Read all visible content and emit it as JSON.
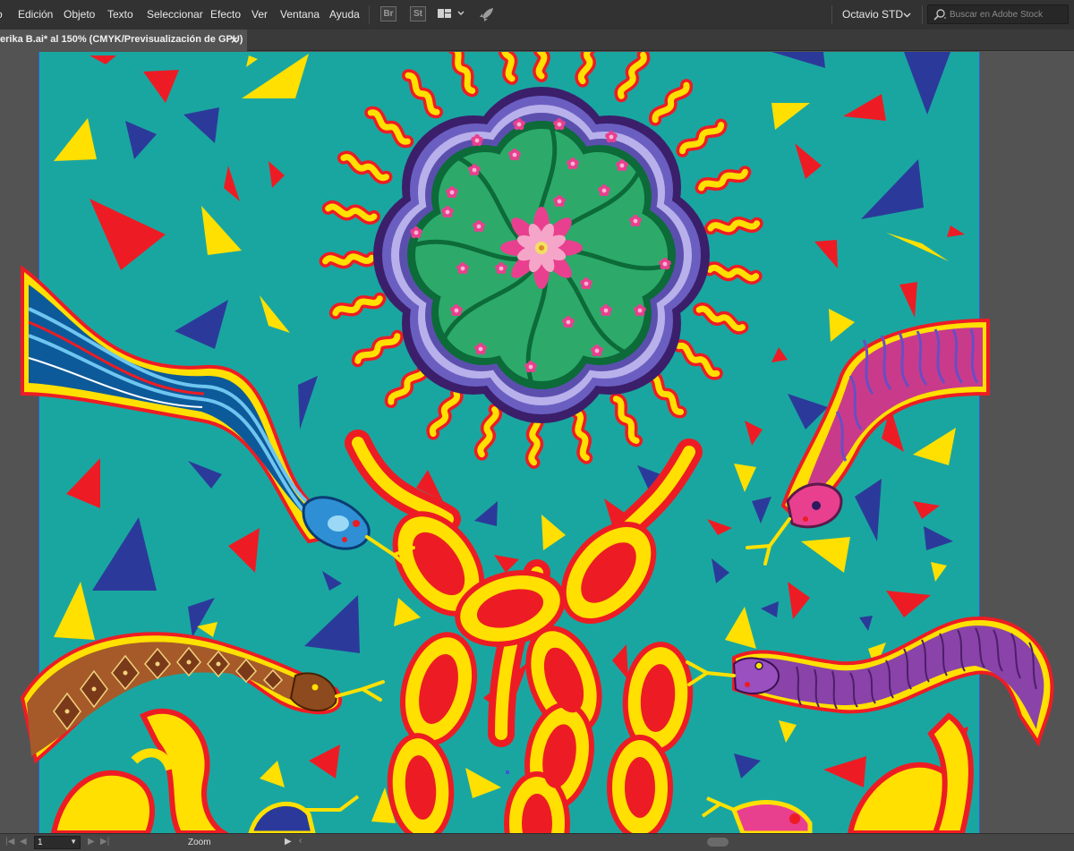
{
  "menubar": {
    "items": [
      "o",
      "Edición",
      "Objeto",
      "Texto",
      "Seleccionar",
      "Efecto",
      "Ver",
      "Ventana",
      "Ayuda"
    ],
    "bridge_label": "Br",
    "stock_label": "St",
    "workspace": "Octavio STD",
    "search_placeholder": "Buscar en Adobe Stock"
  },
  "document": {
    "tab_label": "erika B.ai* al 150% (CMYK/Previsualización de GPU)",
    "close_symbol": "×"
  },
  "statusbar": {
    "page": "1",
    "zoom_label": "Zoom"
  },
  "colors": {
    "canvas_bg": "#1aa6a0",
    "menubar_bg": "#323232",
    "pasteboard": "#535353",
    "red": "#ed1c24",
    "yellow": "#ffe000",
    "blue": "#2b3a9a",
    "green": "#2daa6a",
    "dark_green": "#0c6b38",
    "purple": "#4b3a8a",
    "pink": "#e93f8f"
  }
}
